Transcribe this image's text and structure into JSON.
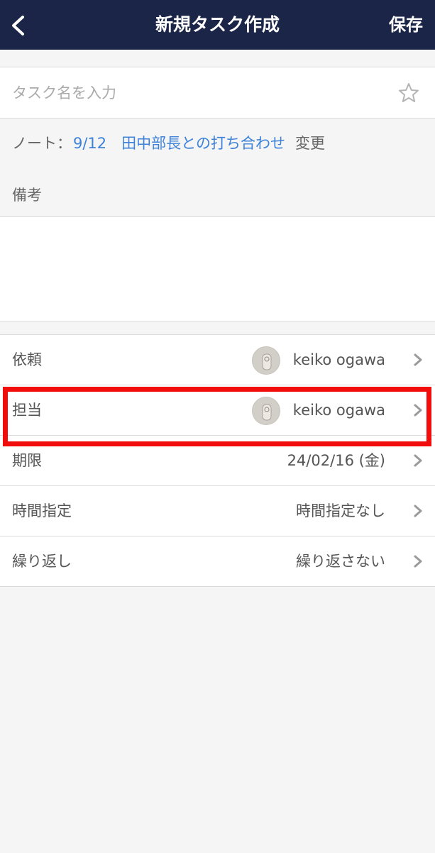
{
  "header": {
    "title": "新規タスク作成",
    "save_label": "保存"
  },
  "task": {
    "placeholder": "タスク名を入力",
    "value": ""
  },
  "note": {
    "prefix": "ノート：",
    "link_text": "9/12　田中部長との打ち合わせ",
    "change_label": "変更"
  },
  "memo": {
    "label": "備考",
    "value": ""
  },
  "settings": {
    "requester": {
      "label": "依頼",
      "value": "keiko ogawa"
    },
    "assignee": {
      "label": "担当",
      "value": "keiko ogawa"
    },
    "due": {
      "label": "期限",
      "value": "24/02/16 (金)"
    },
    "time": {
      "label": "時間指定",
      "value": "時間指定なし"
    },
    "repeat": {
      "label": "繰り返し",
      "value": "繰り返さない"
    }
  },
  "colors": {
    "header_bg": "#1b2547",
    "link": "#3d82d8",
    "highlight": "#f20d0d"
  }
}
